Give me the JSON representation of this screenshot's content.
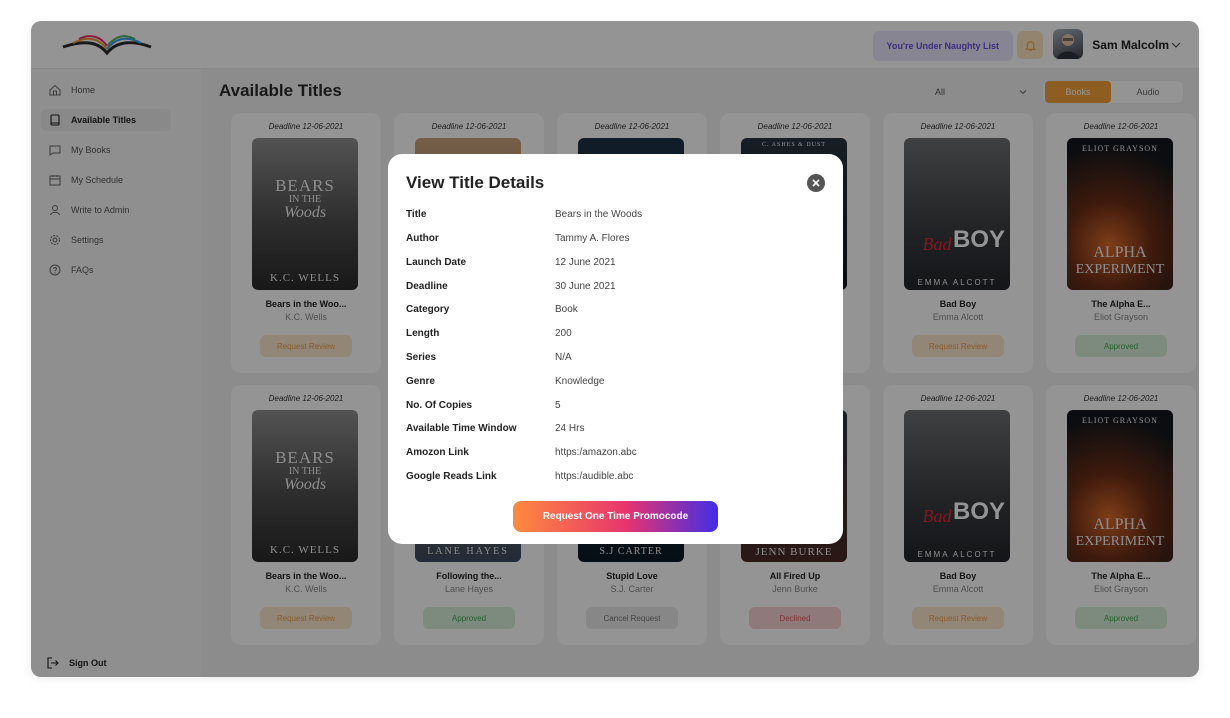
{
  "header": {
    "naughty_label": "You're Under Naughty List",
    "username": "Sam Malcolm"
  },
  "sidebar": {
    "items": [
      {
        "label": "Home",
        "icon": "home-icon"
      },
      {
        "label": "Available Titles",
        "icon": "book-icon"
      },
      {
        "label": "My Books",
        "icon": "chat-icon"
      },
      {
        "label": "My Schedule",
        "icon": "calendar-icon"
      },
      {
        "label": "Write to Admin",
        "icon": "user-icon"
      },
      {
        "label": "Settings",
        "icon": "gear-icon"
      },
      {
        "label": "FAQs",
        "icon": "help-icon"
      }
    ],
    "signout": "Sign Out"
  },
  "main": {
    "title": "Available Titles",
    "filter_value": "All",
    "toggle": [
      "Books",
      "Audio"
    ]
  },
  "cards": [
    {
      "deadline": "Deadline 12-06-2021",
      "title": "Bears in the Woo...",
      "author": "K.C. Wells",
      "action": "Request Review",
      "cover_lines": [
        "BEARS",
        "IN THE",
        "Woods",
        "K.C. WELLS"
      ]
    },
    {
      "deadline": "Deadline 12-06-2021",
      "title": "",
      "author": "",
      "action": "",
      "cover_lines": []
    },
    {
      "deadline": "Deadline 12-06-2021",
      "title": "",
      "author": "",
      "action": "",
      "cover_lines": []
    },
    {
      "deadline": "Deadline 12-06-2021",
      "title": "",
      "author": "",
      "action": "",
      "cover_lines": [
        "C. ASHES & DUST"
      ]
    },
    {
      "deadline": "Deadline 12-06-2021",
      "title": "Bad Boy",
      "author": "Emma Alcott",
      "action": "Request Review",
      "cover_lines": [
        "Bad",
        "BOY",
        "EMMA ALCOTT"
      ]
    },
    {
      "deadline": "Deadline 12-06-2021",
      "title": "The Alpha E...",
      "author": "Eliot Grayson",
      "action": "Approved",
      "cover_lines": [
        "ELIOT GRAYSON",
        "ALPHA",
        "EXPERIMENT"
      ]
    },
    {
      "deadline": "Deadline 12-06-2021",
      "title": "Bears in the Woo...",
      "author": "K.C. Wells",
      "action": "Request Review",
      "cover_lines": [
        "BEARS",
        "IN THE",
        "Woods",
        "K.C. WELLS"
      ]
    },
    {
      "deadline": "",
      "title": "Following the...",
      "author": "Lane Hayes",
      "action": "Approved",
      "cover_lines": [
        "LANE HAYES"
      ]
    },
    {
      "deadline": "",
      "title": "Stupid Love",
      "author": "S.J. Carter",
      "action": "Cancel Request",
      "cover_lines": [
        "S.J CARTER"
      ]
    },
    {
      "deadline": "",
      "title": "All Fired Up",
      "author": "Jenn Burke",
      "action": "Declined",
      "cover_lines": [
        "JENN BURKE"
      ]
    },
    {
      "deadline": "Deadline 12-06-2021",
      "title": "Bad Boy",
      "author": "Emma Alcott",
      "action": "Request Review",
      "cover_lines": [
        "Bad",
        "BOY",
        "EMMA ALCOTT"
      ]
    },
    {
      "deadline": "Deadline 12-06-2021",
      "title": "The Alpha E...",
      "author": "Eliot Grayson",
      "action": "Approved",
      "cover_lines": [
        "ELIOT GRAYSON",
        "ALPHA",
        "EXPERIMENT"
      ]
    }
  ],
  "modal": {
    "title": "View Title Details",
    "rows": [
      {
        "k": "Title",
        "v": "Bears in the Woods"
      },
      {
        "k": "Author",
        "v": "Tammy A. Flores"
      },
      {
        "k": "Launch Date",
        "v": "12 June 2021"
      },
      {
        "k": "Deadline",
        "v": "30 June 2021"
      },
      {
        "k": "Category",
        "v": "Book"
      },
      {
        "k": "Length",
        "v": "200"
      },
      {
        "k": "Series",
        "v": "N/A"
      },
      {
        "k": "Genre",
        "v": "Knowledge"
      },
      {
        "k": "No. Of Copies",
        "v": "5"
      },
      {
        "k": "Available Time Window",
        "v": "24 Hrs"
      },
      {
        "k": "Amozon Link",
        "v": "https:/amazon.abc"
      },
      {
        "k": "Google Reads Link",
        "v": "https:/audible.abc"
      }
    ],
    "button": "Request One Time Promocode"
  },
  "colors": {
    "accent_orange": "#f3a03b",
    "naughty_purple": "#6a4fd8",
    "approved_green": "#3eaa55",
    "declined_red": "#e05560"
  }
}
